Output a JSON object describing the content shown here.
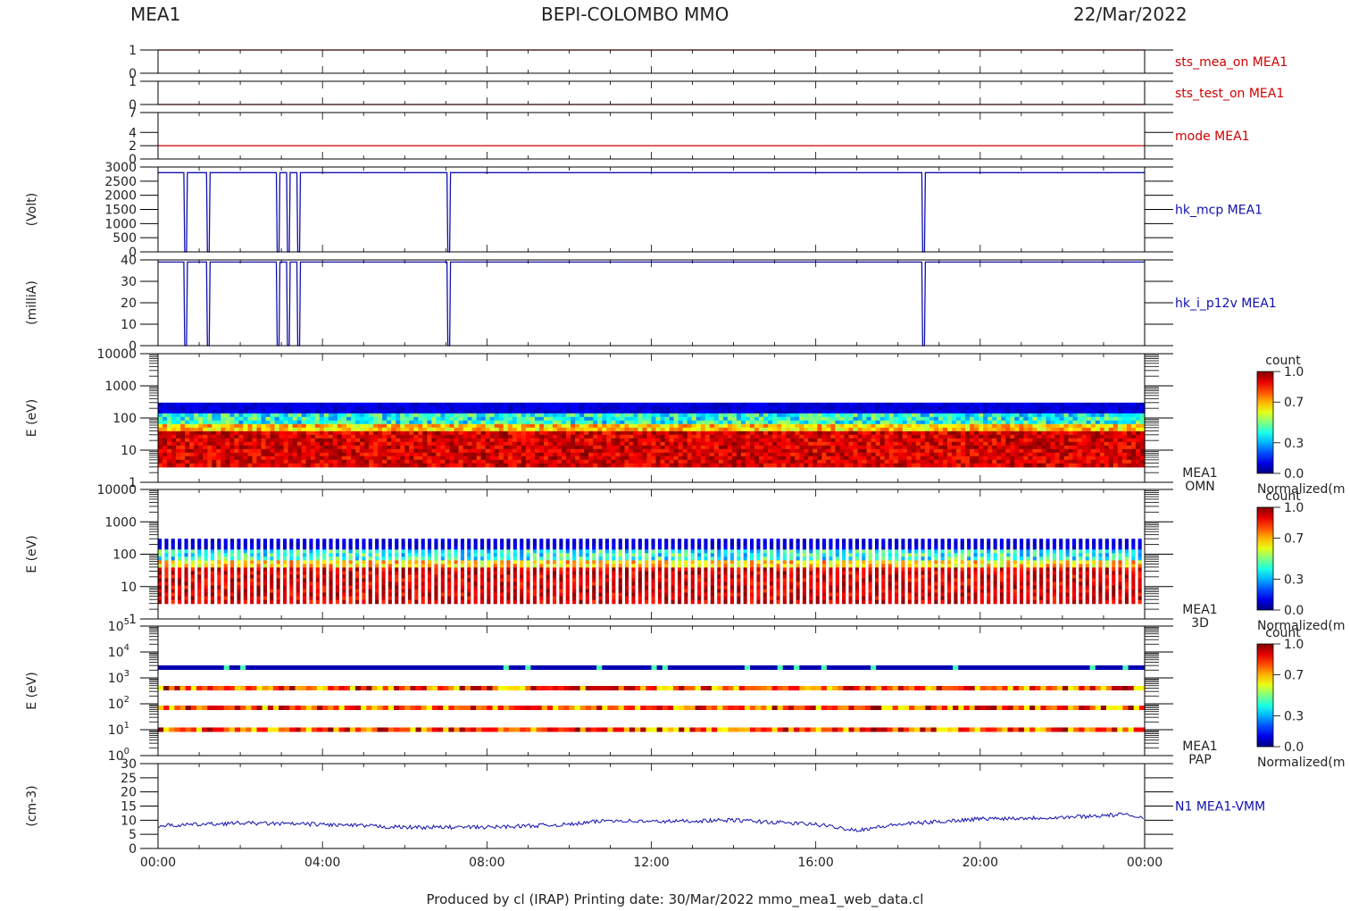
{
  "header": {
    "left": "MEA1",
    "center": "BEPI-COLOMBO MMO",
    "right": "22/Mar/2022"
  },
  "footer": "Produced by cl (IRAP)    Printing date: 30/Mar/2022    mmo_mea1_web_data.cl",
  "colors": {
    "red": "#d00000",
    "blue": "#1010b0",
    "axis": "#000000"
  },
  "chart_data": [
    {
      "type": "line",
      "label": "sts_mea_on MEA1",
      "ylabel": "",
      "yticks": [
        "0",
        "1"
      ],
      "ylim": [
        0,
        1
      ],
      "color": "#d00000",
      "series": [
        {
          "x_hours": [
            0,
            24
          ],
          "values": [
            1,
            1
          ]
        }
      ]
    },
    {
      "type": "line",
      "label": "sts_test_on MEA1",
      "ylabel": "",
      "yticks": [
        "0",
        "1"
      ],
      "ylim": [
        0,
        1
      ],
      "color": "#d00000",
      "series": [
        {
          "x_hours": [
            0,
            24
          ],
          "values": [
            0,
            0
          ]
        }
      ]
    },
    {
      "type": "line",
      "label": "mode MEA1",
      "ylabel": "",
      "yticks": [
        "0",
        "2",
        "4",
        "7"
      ],
      "ylim": [
        0,
        7
      ],
      "color": "#d00000",
      "series": [
        {
          "x_hours": [
            0,
            24
          ],
          "values": [
            2,
            2
          ]
        }
      ]
    },
    {
      "type": "line",
      "label": "hk_mcp MEA1",
      "ylabel": "(Volt)",
      "yticks": [
        "0",
        "500",
        "1000",
        "1500",
        "2000",
        "2500",
        "3000"
      ],
      "ylim": [
        0,
        3000
      ],
      "color": "#1010b0",
      "baseline_value": 0,
      "nominal": 2800,
      "dropouts_hours": [
        0.65,
        1.2,
        2.9,
        3.15,
        3.4,
        7.05,
        18.6
      ]
    },
    {
      "type": "line",
      "label": "hk_i_p12v MEA1",
      "ylabel": "(milliA)",
      "yticks": [
        "0",
        "10",
        "20",
        "30",
        "40"
      ],
      "ylim": [
        0,
        40
      ],
      "color": "#1010b0",
      "baseline_value": 0,
      "nominal": 39,
      "dropouts_hours": [
        0.65,
        1.2,
        2.9,
        3.15,
        3.4,
        7.05,
        18.6
      ]
    },
    {
      "type": "heatmap",
      "label": "MEA1",
      "label2": "OMN",
      "ylabel": "E (eV)",
      "yticks": [
        "1",
        "10",
        "100",
        "1000",
        "10000"
      ],
      "ylim": [
        1,
        10000
      ],
      "yscale": "log",
      "colorbar": {
        "title": "count",
        "ticks": [
          "0.0",
          "0.3",
          "0.7",
          "1.0"
        ],
        "caption": "Normalized(m"
      },
      "emin": 3,
      "emax": 300
    },
    {
      "type": "heatmap",
      "label": "MEA1",
      "label2": "3D",
      "ylabel": "E (eV)",
      "yticks": [
        "1",
        "10",
        "100",
        "1000",
        "10000"
      ],
      "ylim": [
        1,
        10000
      ],
      "yscale": "log",
      "colorbar": {
        "title": "count",
        "ticks": [
          "0.0",
          "0.3",
          "0.7",
          "1.0"
        ],
        "caption": "Normalized(m"
      },
      "emin": 3,
      "emax": 300,
      "striped": true
    },
    {
      "type": "heatmap",
      "label": "MEA1",
      "label2": "PAP",
      "ylabel": "E (eV)",
      "yticks": [
        "10",
        "10",
        "10",
        "10",
        "10",
        "10"
      ],
      "ysup": [
        "0",
        "1",
        "2",
        "3",
        "4",
        "5"
      ],
      "ylim": [
        1,
        100000
      ],
      "yscale": "log",
      "colorbar": {
        "title": "count",
        "ticks": [
          "0.0",
          "0.3",
          "0.7",
          "1.0"
        ],
        "caption": "Normalized(m"
      },
      "bands_eV": [
        2500,
        400,
        70,
        10
      ]
    },
    {
      "type": "line",
      "label": "N1 MEA1-VMM",
      "ylabel": "(cm-3)",
      "yticks": [
        "0",
        "5",
        "10",
        "15",
        "20",
        "25",
        "30"
      ],
      "ylim": [
        0,
        30
      ],
      "color": "#1010b0",
      "series": [
        {
          "x_hours": [
            0,
            2,
            4,
            6,
            8,
            10,
            11,
            12,
            14,
            16,
            17,
            18,
            20,
            22,
            23.5,
            24
          ],
          "values": [
            8,
            9,
            8.5,
            7.5,
            7.5,
            8.5,
            10,
            9.5,
            10,
            8.5,
            6.5,
            8.5,
            10.5,
            11,
            12,
            11
          ]
        }
      ]
    }
  ],
  "xaxis": {
    "ticks": [
      "00:00",
      "04:00",
      "08:00",
      "12:00",
      "16:00",
      "20:00",
      "00:00"
    ],
    "range_hours": [
      0,
      24
    ]
  }
}
